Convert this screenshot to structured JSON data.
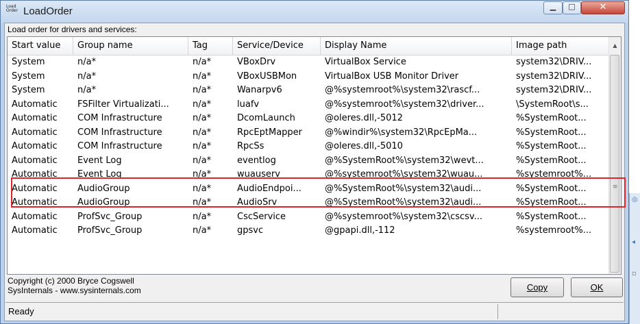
{
  "window": {
    "title": "LoadOrder",
    "icon_text": "Load Order"
  },
  "caption": "Load order for drivers and services:",
  "columns": [
    "Start value",
    "Group name",
    "Tag",
    "Service/Device",
    "Display Name",
    "Image path"
  ],
  "rows": [
    [
      "System",
      "n/a*",
      "n/a*",
      "VBoxDrv",
      "VirtualBox Service",
      "system32\\DRIV..."
    ],
    [
      "System",
      "n/a*",
      "n/a*",
      "VBoxUSBMon",
      "VirtualBox USB Monitor Driver",
      "system32\\DRIV..."
    ],
    [
      "System",
      "n/a*",
      "n/a*",
      "Wanarpv6",
      "@%systemroot%\\system32\\rascf...",
      "system32\\DRIV..."
    ],
    [
      "Automatic",
      "FSFilter Virtualizati...",
      "n/a*",
      "luafv",
      "@%systemroot%\\system32\\driver...",
      "\\SystemRoot\\s..."
    ],
    [
      "Automatic",
      "COM Infrastructure",
      "n/a*",
      "DcomLaunch",
      "@oleres.dll,-5012",
      "%SystemRoot..."
    ],
    [
      "Automatic",
      "COM Infrastructure",
      "n/a*",
      "RpcEptMapper",
      "@%windir%\\system32\\RpcEpMa...",
      "%SystemRoot..."
    ],
    [
      "Automatic",
      "COM Infrastructure",
      "n/a*",
      "RpcSs",
      "@oleres.dll,-5010",
      "%SystemRoot..."
    ],
    [
      "Automatic",
      "Event Log",
      "n/a*",
      "eventlog",
      "@%SystemRoot%\\system32\\wevt...",
      "%SystemRoot..."
    ],
    [
      "Automatic",
      "Event Log",
      "n/a*",
      "wuauserv",
      "@%systemroot%\\system32\\wuau...",
      "%systemroot%..."
    ],
    [
      "Automatic",
      "AudioGroup",
      "n/a*",
      "AudioEndpoi...",
      "@%SystemRoot%\\system32\\audi...",
      "%SystemRoot..."
    ],
    [
      "Automatic",
      "AudioGroup",
      "n/a*",
      "AudioSrv",
      "@%SystemRoot%\\system32\\audi...",
      "%SystemRoot..."
    ],
    [
      "Automatic",
      "ProfSvc_Group",
      "n/a*",
      "CscService",
      "@%systemroot%\\system32\\cscsv...",
      "%SystemRoot..."
    ],
    [
      "Automatic",
      "ProfSvc_Group",
      "n/a*",
      "gpsvc",
      "@gpapi.dll,-112",
      "%systemroot%..."
    ]
  ],
  "footer": {
    "copyright_line1": "Copyright (c) 2000 Bryce Cogswell",
    "copyright_line2": "SysInternals - www.sysinternals.com",
    "copy_label": "Copy",
    "ok_label": "OK"
  },
  "status": "Ready",
  "colors": {
    "highlight": "#e0242b",
    "title_bar": "#c3d7ee"
  }
}
